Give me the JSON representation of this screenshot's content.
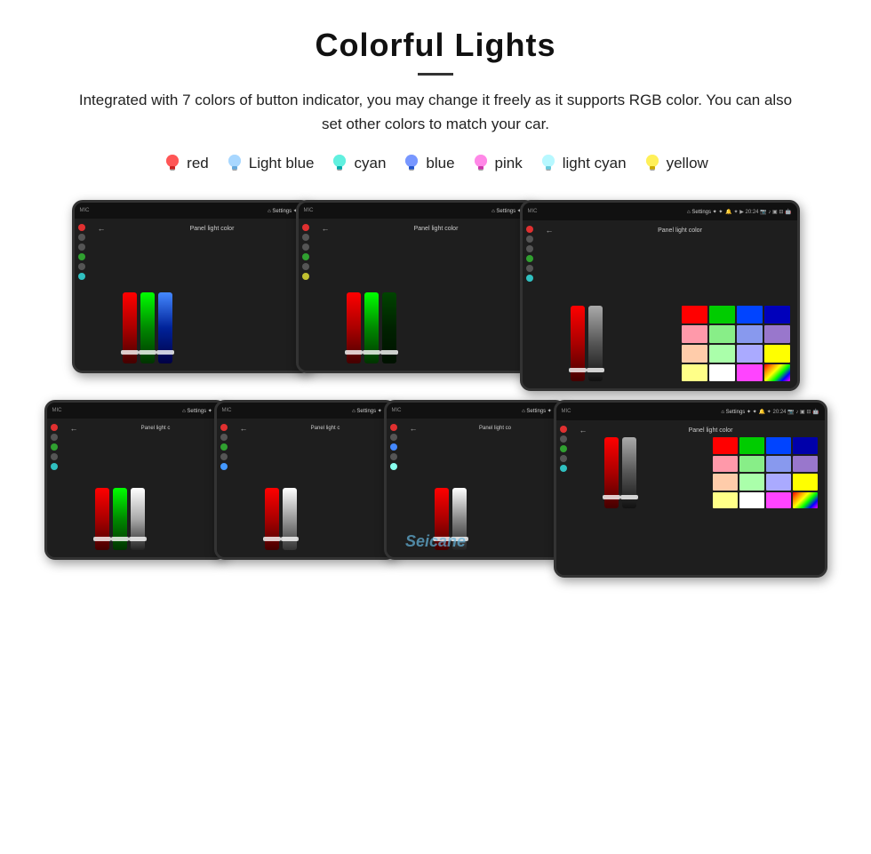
{
  "page": {
    "title": "Colorful Lights",
    "subtitle": "Integrated with 7 colors of button indicator, you may change it freely as it supports RGB color. You can also set other colors to match your car.",
    "colors": [
      {
        "name": "red",
        "color": "#ff2222",
        "bulb_color": "#ff3333",
        "glow": "#ff9999"
      },
      {
        "name": "Light blue",
        "color": "#aaddff",
        "bulb_color": "#88ccff",
        "glow": "#cceeff"
      },
      {
        "name": "cyan",
        "color": "#00ffee",
        "bulb_color": "#00eedd",
        "glow": "#aaffee"
      },
      {
        "name": "blue",
        "color": "#3366ff",
        "bulb_color": "#4477ff",
        "glow": "#99aaff"
      },
      {
        "name": "pink",
        "color": "#ff44cc",
        "bulb_color": "#ff55dd",
        "glow": "#ffaaee"
      },
      {
        "name": "light cyan",
        "color": "#88eeff",
        "bulb_color": "#99eeff",
        "glow": "#ccffff"
      },
      {
        "name": "yellow",
        "color": "#ffee00",
        "bulb_color": "#ffdd00",
        "glow": "#ffff99"
      }
    ],
    "watermark": "Seicane",
    "panel_label": "Panel light color",
    "row1_screens": [
      {
        "id": "screen-1-1",
        "has_palette": false
      },
      {
        "id": "screen-1-2",
        "has_palette": false
      },
      {
        "id": "screen-1-3",
        "has_palette": true
      }
    ],
    "row2_screens": [
      {
        "id": "screen-2-1",
        "has_palette": false
      },
      {
        "id": "screen-2-2",
        "has_palette": false
      },
      {
        "id": "screen-2-3",
        "has_palette": false
      },
      {
        "id": "screen-2-4",
        "has_palette": true
      }
    ],
    "palette_colors": [
      "#ff0000",
      "#00ff00",
      "#0000ff",
      "#ff8800",
      "#ff88aa",
      "#88ff88",
      "#8888ff",
      "#888888",
      "#ffaaaa",
      "#aaffaa",
      "#aaaaff",
      "#ffff00",
      "#ffff44",
      "#ffffff",
      "#ff00ff",
      "#00ffff"
    ]
  }
}
